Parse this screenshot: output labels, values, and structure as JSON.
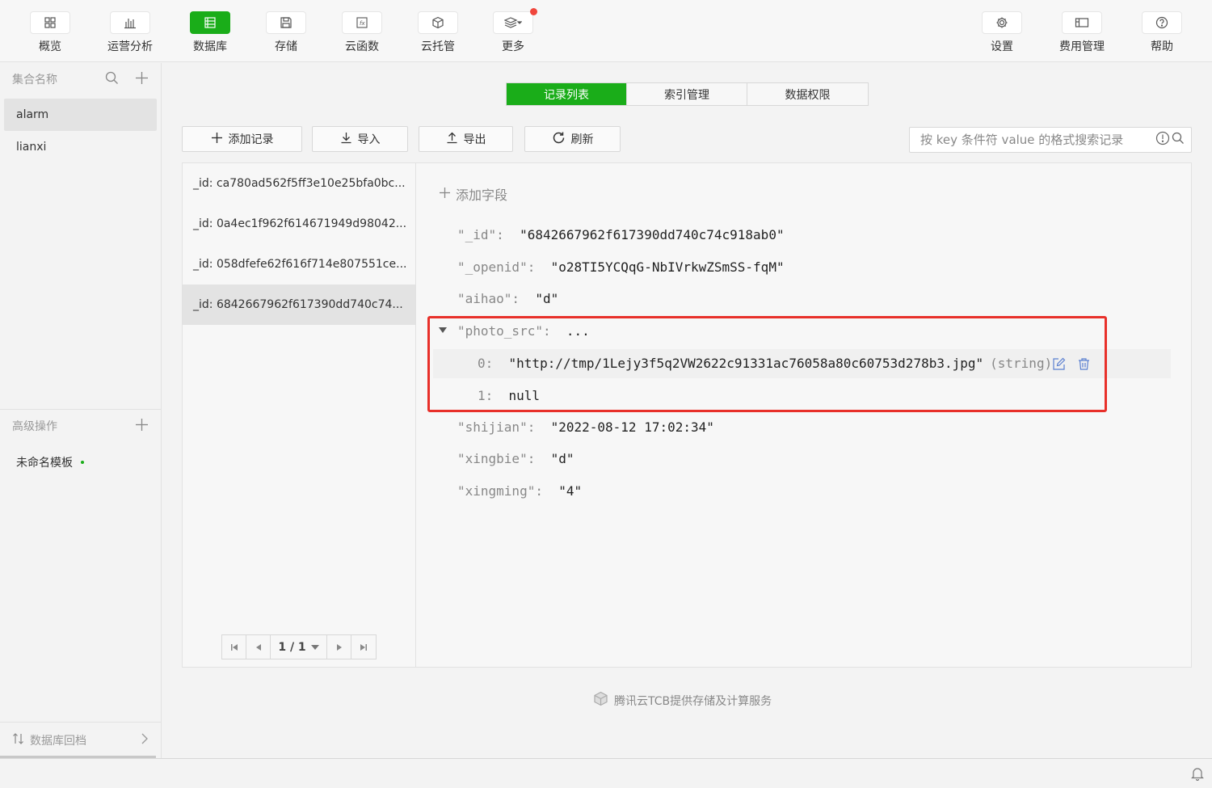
{
  "toolbar": {
    "items": [
      {
        "label": "概览",
        "icon": "grid-icon"
      },
      {
        "label": "运营分析",
        "icon": "bar-chart-icon"
      },
      {
        "label": "数据库",
        "icon": "database-icon",
        "active": true
      },
      {
        "label": "存储",
        "icon": "save-icon"
      },
      {
        "label": "云函数",
        "icon": "function-icon"
      },
      {
        "label": "云托管",
        "icon": "cube-icon"
      },
      {
        "label": "更多",
        "icon": "layers-icon"
      }
    ],
    "right_items": [
      {
        "label": "设置",
        "icon": "gear-icon"
      },
      {
        "label": "费用管理",
        "icon": "billing-icon"
      },
      {
        "label": "帮助",
        "icon": "help-icon"
      }
    ],
    "accent": "#1aad19",
    "notification_dot_color": "#f0463c"
  },
  "sidebar": {
    "collections_header": "集合名称",
    "collections": [
      "alarm",
      "lianxi"
    ],
    "advanced_header": "高级操作",
    "templates": [
      "未命名模板"
    ],
    "footer": "数据库回档"
  },
  "tabs": [
    "记录列表",
    "索引管理",
    "数据权限"
  ],
  "actions": {
    "add_record": "添加记录",
    "import": "导入",
    "export": "导出",
    "refresh": "刷新"
  },
  "search": {
    "placeholder": "按 key 条件符 value 的格式搜索记录"
  },
  "records": [
    "_id: ca780ad562f5ff3e10e25bfa0bc...",
    "_id: 0a4ec1f962f614671949d98042...",
    "_id: 058dfefe62f616f714e807551ce...",
    "_id: 6842667962f617390dd740c74..."
  ],
  "pager": {
    "label": "1 / 1"
  },
  "detail": {
    "add_field": "添加字段",
    "fields": {
      "id": {
        "key": "\"_id\":",
        "value": "\"6842667962f617390dd740c74c918ab0\""
      },
      "openid": {
        "key": "\"_openid\":",
        "value": "\"o28TI5YCQqG-NbIVrkwZSmSS-fqM\""
      },
      "aihao": {
        "key": "\"aihao\":",
        "value": "\"d\""
      },
      "photo_src": {
        "key": "\"photo_src\":",
        "value": "..."
      },
      "photo_0": {
        "key": "0:",
        "value": "\"http://tmp/1Lejy3f5q2VW2622c91331ac76058a80c60753d278b3.jpg\"",
        "type": "(string)"
      },
      "photo_1": {
        "key": "1:",
        "value": "null"
      },
      "shijian": {
        "key": "\"shijian\":",
        "value": "\"2022-08-12 17:02:34\""
      },
      "xingbie": {
        "key": "\"xingbie\":",
        "value": "\"d\""
      },
      "xingming": {
        "key": "\"xingming\":",
        "value": "\"4\""
      }
    },
    "highlight_color": "#e8302a"
  },
  "credit": "腾讯云TCB提供存储及计算服务"
}
